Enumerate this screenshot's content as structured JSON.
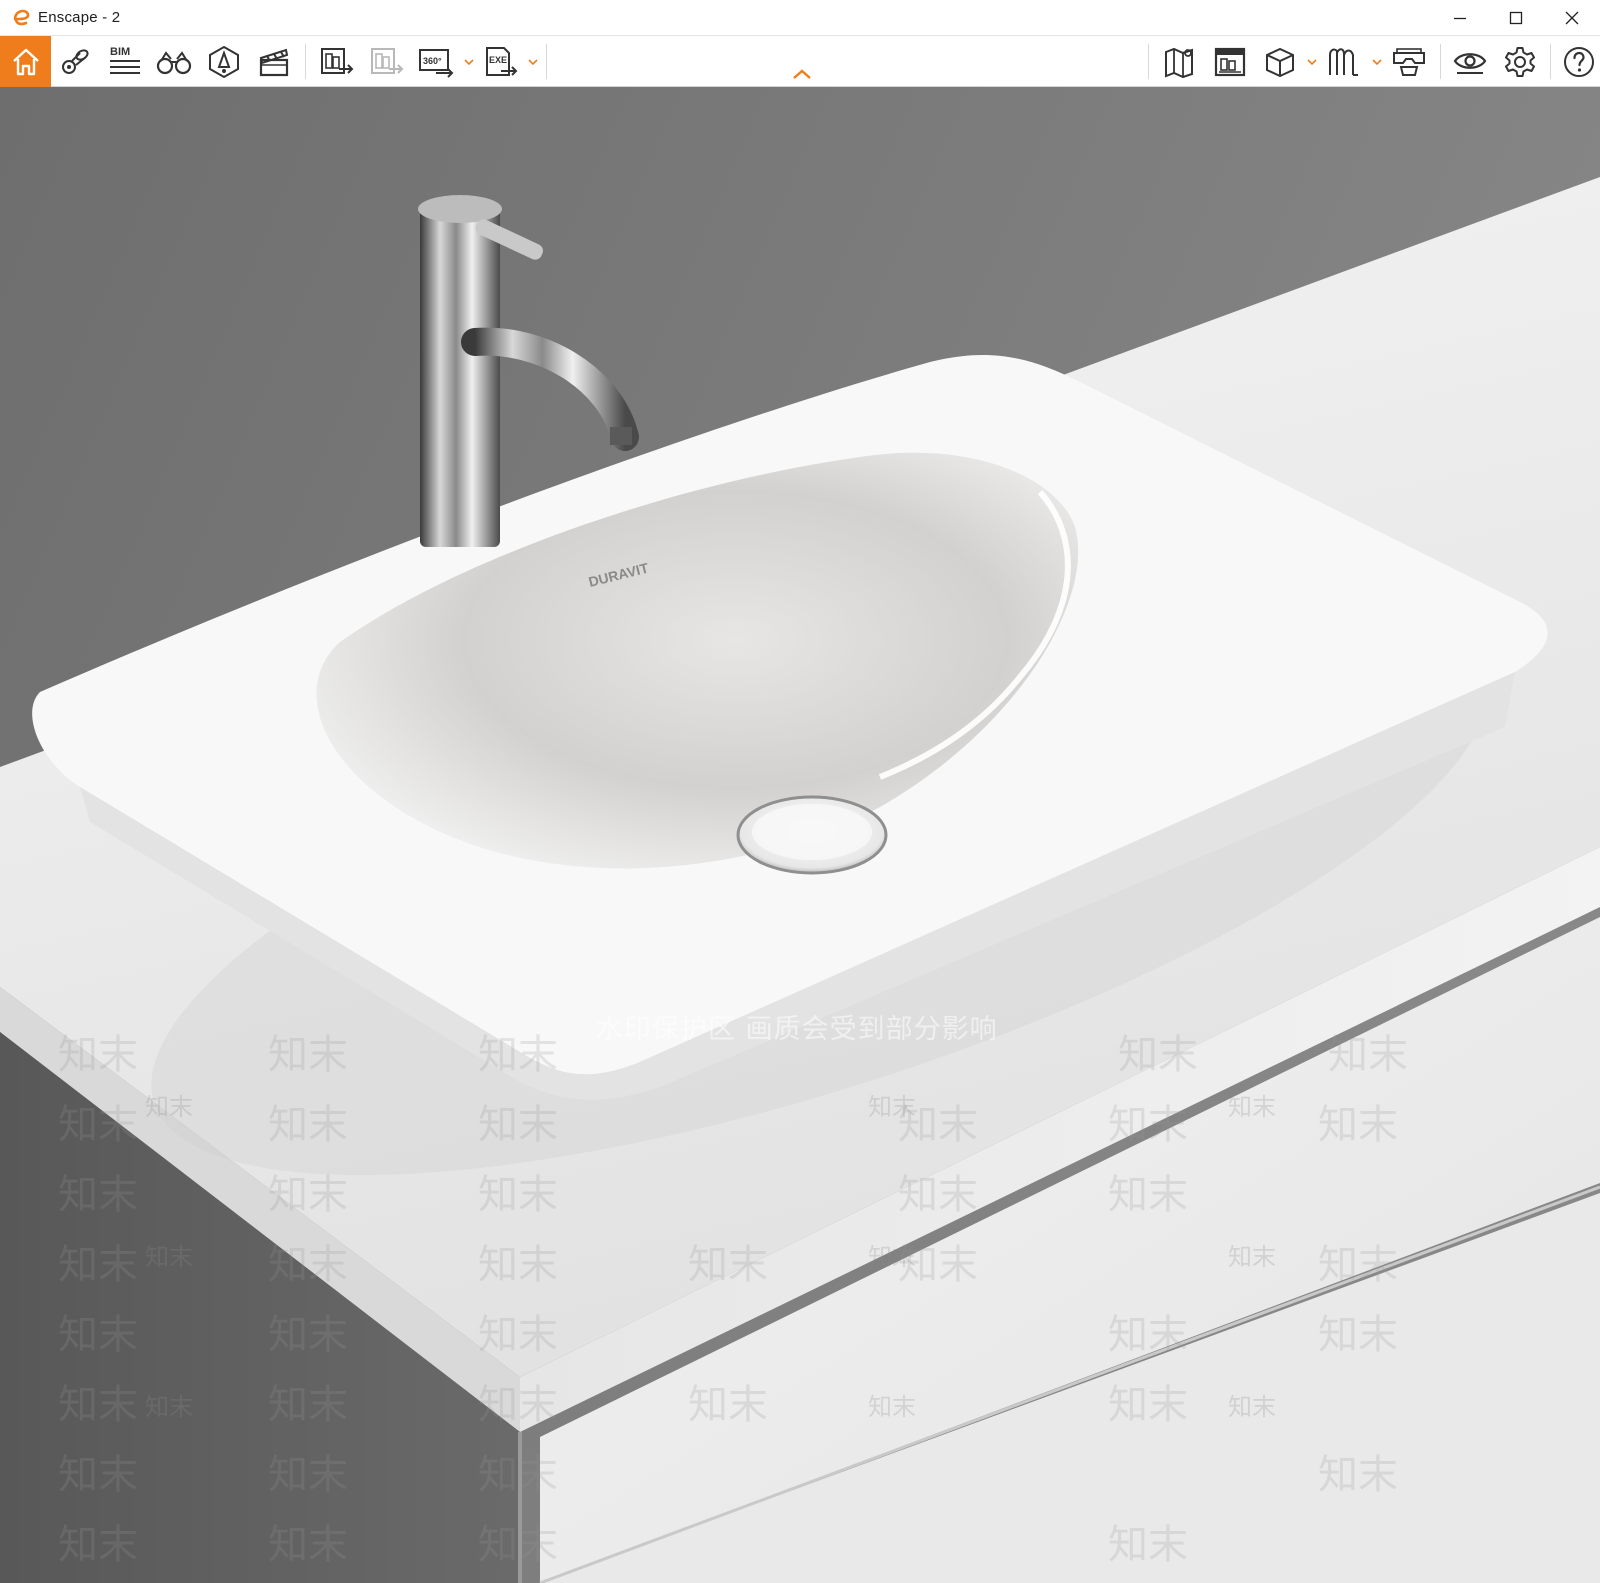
{
  "window": {
    "title": "Enscape - 2",
    "accent_color": "#f07d1b"
  },
  "window_controls": [
    "minimize-icon",
    "maximize-icon",
    "close-icon"
  ],
  "toolbar": {
    "left_tools": [
      {
        "name": "home",
        "icon": "home-icon",
        "active": true
      },
      {
        "name": "views",
        "icon": "location-views-icon"
      },
      {
        "name": "bim",
        "icon": "bim-info-icon",
        "label": "BIM"
      },
      {
        "name": "binoculars",
        "icon": "binoculars-icon"
      },
      {
        "name": "assets",
        "icon": "asset-library-icon"
      },
      {
        "name": "video",
        "icon": "video-editor-icon"
      },
      {
        "name": "render-image",
        "icon": "screenshot-export-icon"
      },
      {
        "name": "batch-render",
        "icon": "batch-render-icon",
        "disabled": true
      },
      {
        "name": "panorama",
        "icon": "panorama-360-icon",
        "label": "360°"
      },
      {
        "name": "export-exe",
        "icon": "export-exe-icon",
        "label": "EXE"
      }
    ],
    "right_tools": [
      {
        "name": "map",
        "icon": "map-icon"
      },
      {
        "name": "atlas",
        "icon": "material-editor-icon"
      },
      {
        "name": "cube",
        "icon": "view-cube-icon"
      },
      {
        "name": "vr-mode",
        "icon": "vr-headset-icon"
      },
      {
        "name": "vr-link",
        "icon": "vr-controller-icon"
      },
      {
        "name": "visibility",
        "icon": "eye-icon"
      },
      {
        "name": "settings",
        "icon": "gear-icon"
      },
      {
        "name": "help",
        "icon": "help-icon"
      }
    ]
  },
  "render": {
    "brand_mark": "DURAVIT",
    "watermark_banner": "水印保护区  画质会受到部分影响",
    "watermark_text": "知末"
  }
}
